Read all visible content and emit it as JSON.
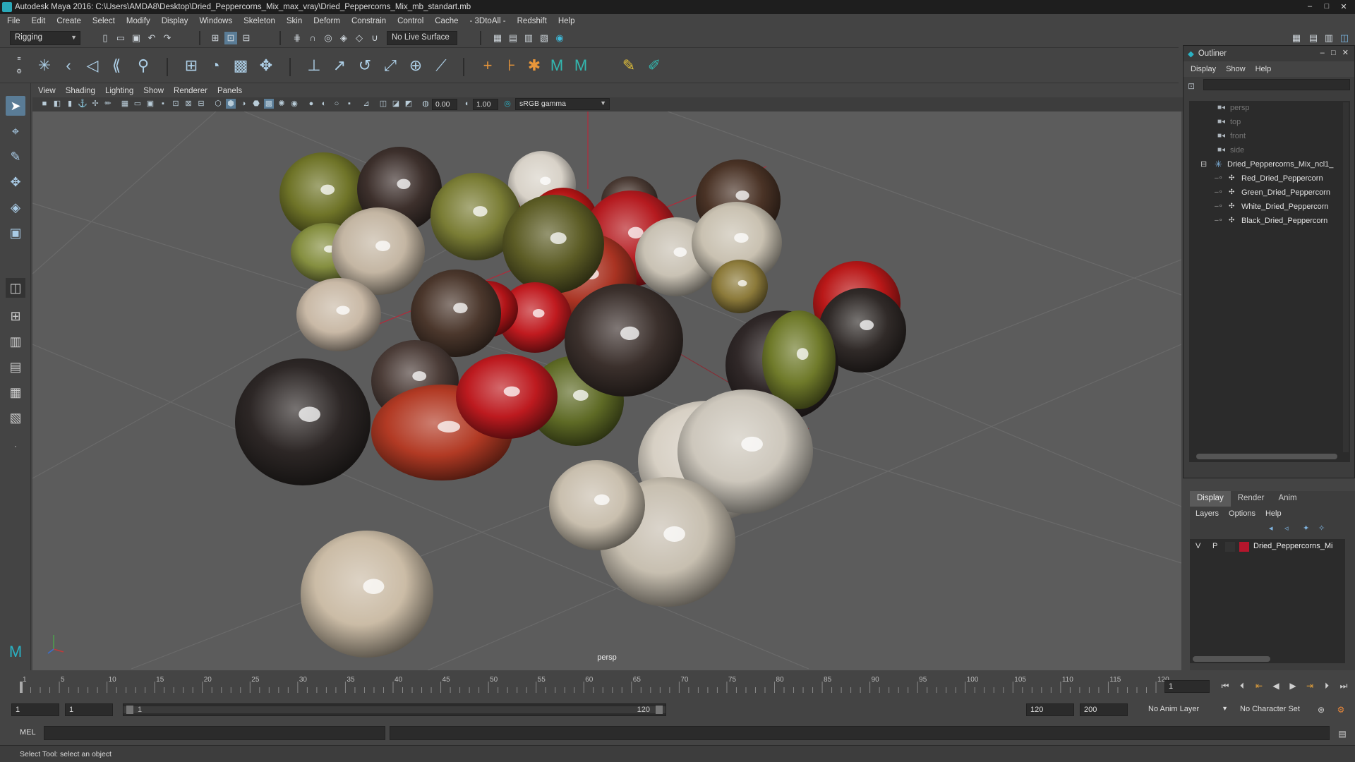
{
  "title": "Autodesk Maya 2016: C:\\Users\\AMDA8\\Desktop\\Dried_Peppercorns_Mix_max_vray\\Dried_Peppercorns_Mix_mb_standart.mb",
  "window_controls": [
    "–",
    "□",
    "✕"
  ],
  "menu": [
    "File",
    "Edit",
    "Create",
    "Select",
    "Modify",
    "Display",
    "Windows",
    "Skeleton",
    "Skin",
    "Deform",
    "Constrain",
    "Control",
    "Cache",
    "- 3DtoAll -",
    "Redshift",
    "Help"
  ],
  "toolbar": {
    "mode": "Rigging",
    "live_surface": "No Live Surface"
  },
  "panel_menu": [
    "View",
    "Shading",
    "Lighting",
    "Show",
    "Renderer",
    "Panels"
  ],
  "panel_toolbar": {
    "exposure": "0.00",
    "gamma": "1.00",
    "color_space": "sRGB gamma"
  },
  "viewport": {
    "camera": "persp",
    "background": "#5c5c5c",
    "grid_color": "#6a6a6a"
  },
  "outliner": {
    "title": "Outliner",
    "menu": [
      "Display",
      "Show",
      "Help"
    ],
    "items": [
      {
        "label": "persp",
        "icon": "camera-icon",
        "dim": true
      },
      {
        "label": "top",
        "icon": "camera-icon",
        "dim": true
      },
      {
        "label": "front",
        "icon": "camera-icon",
        "dim": true
      },
      {
        "label": "side",
        "icon": "camera-icon",
        "dim": true
      },
      {
        "label": "Dried_Peppercorns_Mix_ncl1_",
        "icon": "group-icon",
        "dim": false
      },
      {
        "label": "Red_Dried_Peppercorn",
        "icon": "mesh-icon",
        "dim": false
      },
      {
        "label": "Green_Dried_Peppercorn",
        "icon": "mesh-icon",
        "dim": false
      },
      {
        "label": "White_Dried_Peppercorn",
        "icon": "mesh-icon",
        "dim": false
      },
      {
        "label": "Black_Dried_Peppercorn",
        "icon": "mesh-icon",
        "dim": false
      }
    ]
  },
  "layers": {
    "tabs": [
      "Display",
      "Render",
      "Anim"
    ],
    "active_tab": "Display",
    "menu": [
      "Layers",
      "Options",
      "Help"
    ],
    "rows": [
      {
        "v": "V",
        "p": "P",
        "color": "#b5162c",
        "name": "Dried_Peppercorns_Mi"
      }
    ]
  },
  "timeline": {
    "ticks": [
      "1",
      "5",
      "10",
      "15",
      "20",
      "25",
      "30",
      "35",
      "40",
      "45",
      "50",
      "55",
      "60",
      "65",
      "70",
      "75",
      "80",
      "85",
      "90",
      "95",
      "100",
      "105",
      "110",
      "115",
      "120"
    ],
    "current_frame": "1"
  },
  "range": {
    "start": "1",
    "inner_start": "1",
    "range_start_label": "1",
    "range_end_label": "120",
    "end": "120",
    "max": "200",
    "anim_layer": "No Anim Layer",
    "character_set": "No Character Set"
  },
  "command": {
    "language": "MEL"
  },
  "help_line": "Select Tool: select an object",
  "peppercorns": [
    {
      "color": "#6f7428",
      "type": "green"
    },
    {
      "color": "#3d302c",
      "type": "black"
    },
    {
      "color": "#d8d2c8",
      "type": "white"
    },
    {
      "color": "#4a3a33",
      "type": "black"
    },
    {
      "color": "#4a3326",
      "type": "black"
    },
    {
      "color": "#a22018",
      "type": "red"
    },
    {
      "color": "#7a7d35",
      "type": "green"
    },
    {
      "color": "#b31515",
      "type": "red"
    },
    {
      "color": "#b51a1f",
      "type": "red"
    },
    {
      "color": "#c9c2b4",
      "type": "white"
    },
    {
      "color": "#858f40",
      "type": "green"
    },
    {
      "color": "#c4b6a3",
      "type": "white"
    },
    {
      "color": "#c9c1b1",
      "type": "white"
    },
    {
      "color": "#b91818",
      "type": "red"
    },
    {
      "color": "#a93322",
      "type": "red"
    },
    {
      "color": "#5c5c25",
      "type": "green"
    },
    {
      "color": "#8c7a3a",
      "type": "green"
    },
    {
      "color": "#c01a1f",
      "type": "red"
    },
    {
      "color": "#302a28",
      "type": "black"
    },
    {
      "color": "#b21418",
      "type": "red"
    },
    {
      "color": "#4b372c",
      "type": "black"
    },
    {
      "color": "#c9b9a6",
      "type": "white"
    },
    {
      "color": "#302828",
      "type": "black"
    },
    {
      "color": "#6f7a2a",
      "type": "green"
    },
    {
      "color": "#4c3d38",
      "type": "black"
    },
    {
      "color": "#d7d0c4",
      "type": "white"
    },
    {
      "color": "#2d2726",
      "type": "black"
    },
    {
      "color": "#b23a24",
      "type": "red"
    },
    {
      "color": "#5e6a25",
      "type": "green"
    },
    {
      "color": "#cdc7bc",
      "type": "white"
    },
    {
      "color": "#3b302c",
      "type": "black"
    },
    {
      "color": "#bd1a1f",
      "type": "red"
    },
    {
      "color": "#cbbca6",
      "type": "white"
    },
    {
      "color": "#c7bfb0",
      "type": "white"
    },
    {
      "color": "#c9bfae",
      "type": "white"
    }
  ]
}
